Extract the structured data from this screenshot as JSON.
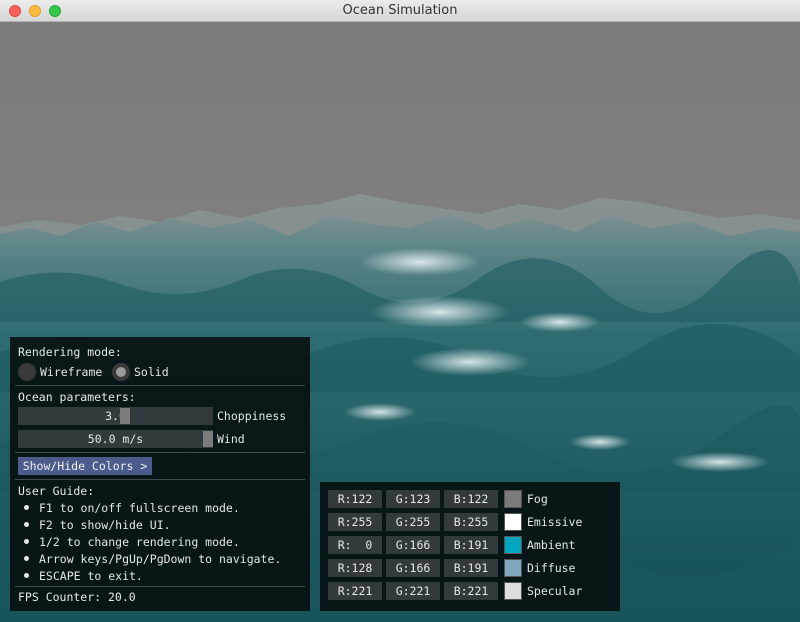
{
  "window": {
    "title": "Ocean Simulation"
  },
  "ui": {
    "rendering_label": "Rendering mode:",
    "modes": [
      {
        "label": "Wireframe",
        "selected": false
      },
      {
        "label": "Solid",
        "selected": true
      }
    ],
    "ocean_label": "Ocean parameters:",
    "sliders": [
      {
        "value": "3.0",
        "label": "Choppiness",
        "level": 0.55
      },
      {
        "value": "50.0 m/s",
        "label": "Wind",
        "level": 1.0
      }
    ],
    "colors_button": "Show/Hide Colors >",
    "guide_title": "User Guide:",
    "guide": [
      "F1 to on/off fullscreen mode.",
      "F2 to show/hide UI.",
      "1/2 to change rendering mode.",
      "Arrow keys/PgUp/PgDown to navigate.",
      "ESCAPE to exit."
    ],
    "fps": "FPS Counter: 20.0"
  },
  "colors": [
    {
      "name": "Fog",
      "r": "R:122",
      "g": "G:123",
      "b": "B:122",
      "hex": "#7a7b7a"
    },
    {
      "name": "Emissive",
      "r": "R:255",
      "g": "G:255",
      "b": "B:255",
      "hex": "#ffffff"
    },
    {
      "name": "Ambient",
      "r": "R:  0",
      "g": "G:166",
      "b": "B:191",
      "hex": "#00a6bf"
    },
    {
      "name": "Diffuse",
      "r": "R:128",
      "g": "G:166",
      "b": "B:191",
      "hex": "#80a6bf"
    },
    {
      "name": "Specular",
      "r": "R:221",
      "g": "G:221",
      "b": "B:221",
      "hex": "#dddddd"
    }
  ]
}
